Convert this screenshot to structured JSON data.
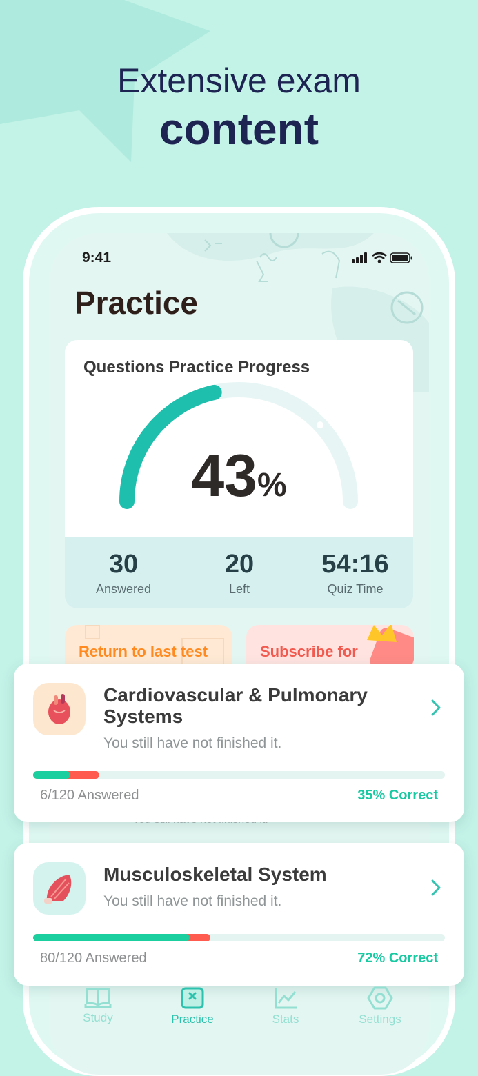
{
  "headline": {
    "line1": "Extensive exam",
    "line2": "content"
  },
  "status_bar": {
    "time": "9:41"
  },
  "page_title": "Practice",
  "progress_card": {
    "title": "Questions Practice Progress",
    "percent_value": "43",
    "percent_sign": "%",
    "progress_fraction": 0.43,
    "stats": [
      {
        "value": "30",
        "label": "Answered"
      },
      {
        "value": "20",
        "label": "Left"
      },
      {
        "value": "54:16",
        "label": "Quiz Time"
      }
    ]
  },
  "shortcuts": {
    "return_label": "Return to last test",
    "subscribe_label": "Subscribe for"
  },
  "background_hint": "You still have not finished it.",
  "sections": [
    {
      "title": "Cardiovascular & Pulmonary Systems",
      "subtitle": "You still have not finished it.",
      "answered": "6/120 Answered",
      "correct": "35% Correct",
      "green_fraction": 0.09,
      "total_fraction": 0.16,
      "icon": "heart-icon"
    },
    {
      "title": "Musculoskeletal System",
      "subtitle": "You still have not finished it.",
      "answered": "80/120 Answered",
      "correct": "72% Correct",
      "green_fraction": 0.38,
      "total_fraction": 0.43,
      "icon": "muscle-icon"
    }
  ],
  "tabs": [
    {
      "label": "Study",
      "icon": "book-icon",
      "active": false
    },
    {
      "label": "Practice",
      "icon": "practice-icon",
      "active": true
    },
    {
      "label": "Stats",
      "icon": "stats-icon",
      "active": false
    },
    {
      "label": "Settings",
      "icon": "settings-icon",
      "active": false
    }
  ],
  "colors": {
    "background": "#c3f2e7",
    "headline": "#1e2452",
    "accent_teal": "#1fbfad",
    "progress_green": "#1ccf9e",
    "progress_red": "#ff5b4f"
  }
}
